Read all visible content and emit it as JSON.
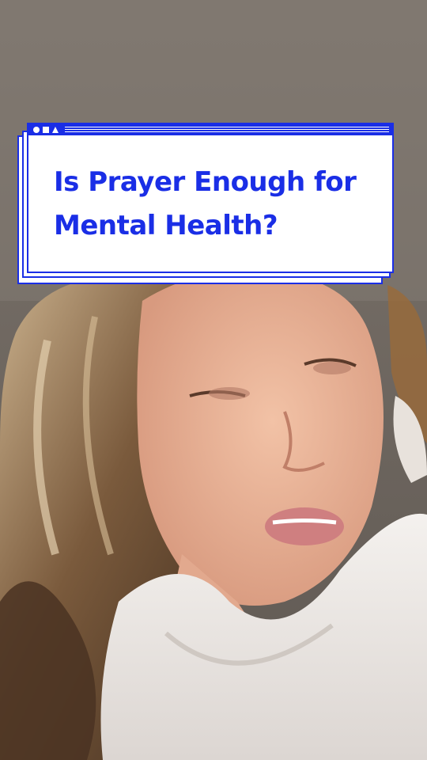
{
  "overlay": {
    "title": "Is Prayer Enough for Mental Health?",
    "accent_color": "#1a2ee6",
    "window_controls": [
      "circle-icon",
      "square-icon",
      "triangle-icon"
    ]
  }
}
